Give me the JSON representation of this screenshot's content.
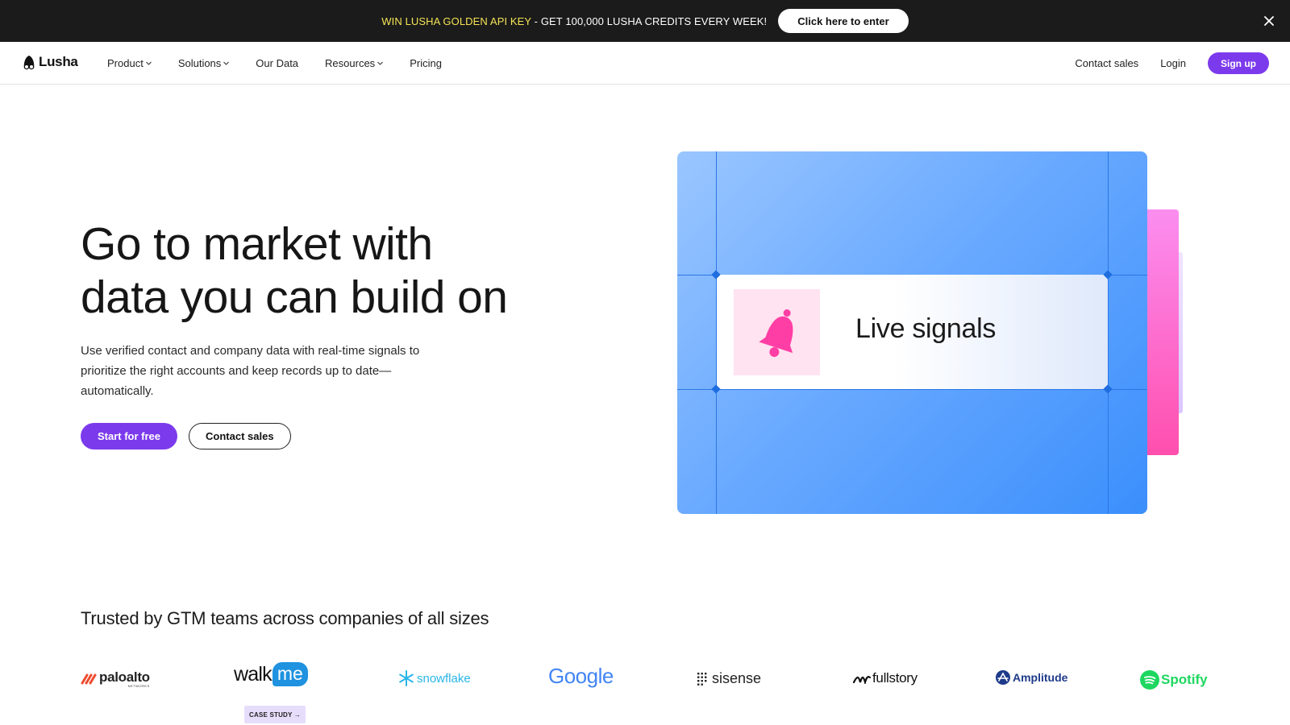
{
  "promo": {
    "highlight": "WIN LUSHA GOLDEN API KEY",
    "text": " - GET 100,000 LUSHA CREDITS EVERY WEEK!",
    "button": "Click here to enter",
    "close_icon": "close-icon"
  },
  "nav": {
    "logo": "Lusha",
    "links": [
      {
        "label": "Product",
        "dropdown": true
      },
      {
        "label": "Solutions",
        "dropdown": true
      },
      {
        "label": "Our Data",
        "dropdown": false
      },
      {
        "label": "Resources",
        "dropdown": true
      },
      {
        "label": "Pricing",
        "dropdown": false
      }
    ],
    "contact_sales": "Contact sales",
    "login": "Login",
    "signup": "Sign up"
  },
  "hero": {
    "title_line1": "Go to market with",
    "title_line2": "data you can build on",
    "subtitle": "Use verified contact and company data with real-time signals to prioritize the right accounts and keep records up to date—automatically.",
    "cta_primary": "Start for free",
    "cta_secondary": "Contact sales"
  },
  "illustration": {
    "label": "Live signals",
    "icon": "bell-icon"
  },
  "trusted": {
    "heading": "Trusted by GTM teams across companies of all sizes",
    "logos": [
      {
        "name": "paloalto",
        "sub": "NETWORKS"
      },
      {
        "name": "walk",
        "suffix": "me"
      },
      {
        "name": "snowflake"
      },
      {
        "name": "Google"
      },
      {
        "name": "sisense"
      },
      {
        "name": "fullstory"
      },
      {
        "name": "Amplitude"
      },
      {
        "name": "Spotify"
      }
    ],
    "case_study": "CASE STUDY →"
  },
  "colors": {
    "accent": "#7c3aed",
    "promo_bg": "#1b1b1b",
    "promo_highlight": "#f5e455",
    "signal_pink": "#ff3ea5"
  }
}
